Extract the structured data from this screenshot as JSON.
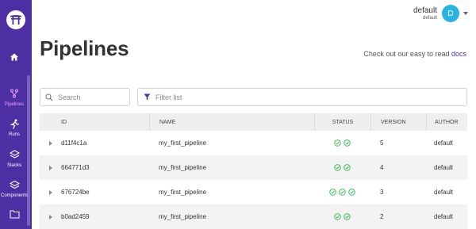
{
  "sidebar": {
    "items": [
      {
        "label": "",
        "icon": "home-icon"
      },
      {
        "label": "Pipelines",
        "icon": "pipelines-icon",
        "active": true
      },
      {
        "label": "Runs",
        "icon": "runs-icon"
      },
      {
        "label": "Stacks",
        "icon": "stacks-icon"
      },
      {
        "label": "Components",
        "icon": "components-icon"
      },
      {
        "label": "",
        "icon": "folder-icon"
      }
    ]
  },
  "user": {
    "name": "default",
    "subtitle": "default",
    "initial": "D"
  },
  "page": {
    "title": "Pipelines",
    "docs_prefix": "Check out our easy to read",
    "docs_link": "docs"
  },
  "search": {
    "placeholder": "Search",
    "value": ""
  },
  "filter": {
    "placeholder": "Filter list",
    "value": ""
  },
  "table": {
    "headers": {
      "id": "ID",
      "name": "NAME",
      "status": "STATUS",
      "version": "VERSION",
      "author": "AUTHOR"
    },
    "rows": [
      {
        "id": "d11f4c1a",
        "name": "my_first_pipeline",
        "status_count": 2,
        "version": "5",
        "author": "default"
      },
      {
        "id": "664771d3",
        "name": "my_first_pipeline",
        "status_count": 2,
        "version": "4",
        "author": "default"
      },
      {
        "id": "676724be",
        "name": "my_first_pipeline",
        "status_count": 3,
        "version": "3",
        "author": "default"
      },
      {
        "id": "b0ad2459",
        "name": "my_first_pipeline",
        "status_count": 2,
        "version": "2",
        "author": "default"
      }
    ]
  },
  "colors": {
    "sidebar": "#4c2fa3",
    "accent": "#4c2fa3",
    "success": "#2fb34e",
    "avatar": "#29b3e3"
  }
}
